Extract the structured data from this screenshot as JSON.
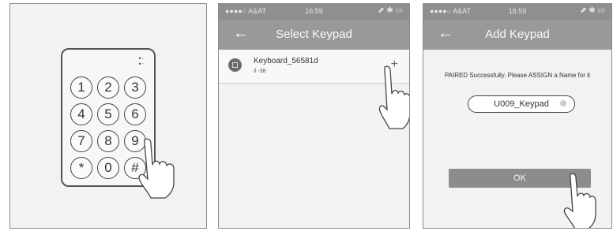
{
  "keypad": {
    "keys": [
      "1",
      "2",
      "3",
      "4",
      "5",
      "6",
      "7",
      "8",
      "9",
      "*",
      "0",
      "#"
    ]
  },
  "status_bar": {
    "carrier": "●●●●○ A&AT",
    "time": "16:59",
    "indicators": "⬈ ✱ ▭"
  },
  "select_screen": {
    "back_icon": "arrow-left-icon",
    "title": "Select Keypad",
    "device_name": "Keyboard_56581d",
    "signal": "ıl -38",
    "add_symbol": "+"
  },
  "add_screen": {
    "back_icon": "arrow-left-icon",
    "title": "Add Keypad",
    "message": "PAIRED Successfully. Please ASSIGN a Name for it",
    "name_value": "U009_Keypad",
    "ok_label": "OK"
  },
  "colors": {
    "header": "#999999",
    "status": "#8f8f8f",
    "button": "#8c8c8c"
  }
}
